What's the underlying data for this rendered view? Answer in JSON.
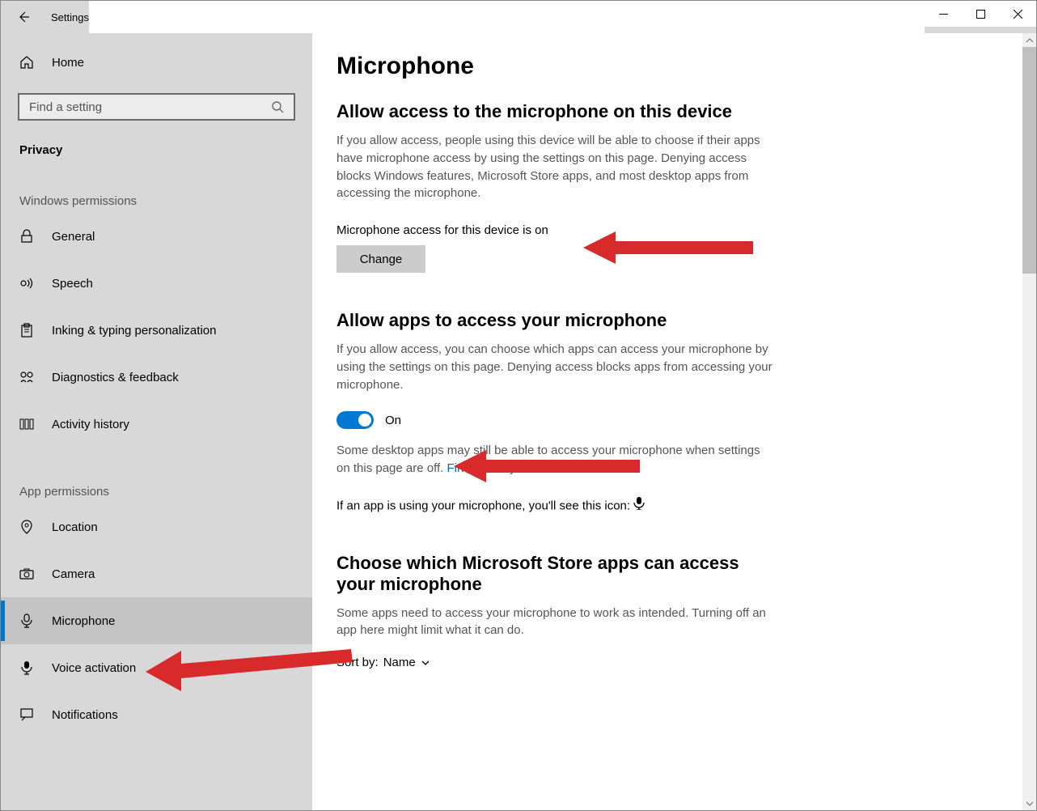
{
  "titlebar": {
    "title": "Settings"
  },
  "sidebar": {
    "home": "Home",
    "search_placeholder": "Find a setting",
    "section": "Privacy",
    "group1": "Windows permissions",
    "group2": "App permissions",
    "items_win": [
      {
        "label": "General"
      },
      {
        "label": "Speech"
      },
      {
        "label": "Inking & typing personalization"
      },
      {
        "label": "Diagnostics & feedback"
      },
      {
        "label": "Activity history"
      }
    ],
    "items_app": [
      {
        "label": "Location"
      },
      {
        "label": "Camera"
      },
      {
        "label": "Microphone"
      },
      {
        "label": "Voice activation"
      },
      {
        "label": "Notifications"
      }
    ]
  },
  "content": {
    "title": "Microphone",
    "sec1": {
      "heading": "Allow access to the microphone on this device",
      "desc": "If you allow access, people using this device will be able to choose if their apps have microphone access by using the settings on this page. Denying access blocks Windows features, Microsoft Store apps, and most desktop apps from accessing the microphone.",
      "status": "Microphone access for this device is on",
      "change": "Change"
    },
    "sec2": {
      "heading": "Allow apps to access your microphone",
      "desc": "If you allow access, you can choose which apps can access your microphone by using the settings on this page. Denying access blocks apps from accessing your microphone.",
      "toggle": "On",
      "note_pre": "Some desktop apps may still be able to access your microphone when settings on this page are off. ",
      "note_link": "Find out why",
      "icon_line": "If an app is using your microphone, you'll see this icon:"
    },
    "sec3": {
      "heading": "Choose which Microsoft Store apps can access your microphone",
      "desc": "Some apps need to access your microphone to work as intended. Turning off an app here might limit what it can do.",
      "sort_label": "Sort by:",
      "sort_value": "Name"
    }
  }
}
